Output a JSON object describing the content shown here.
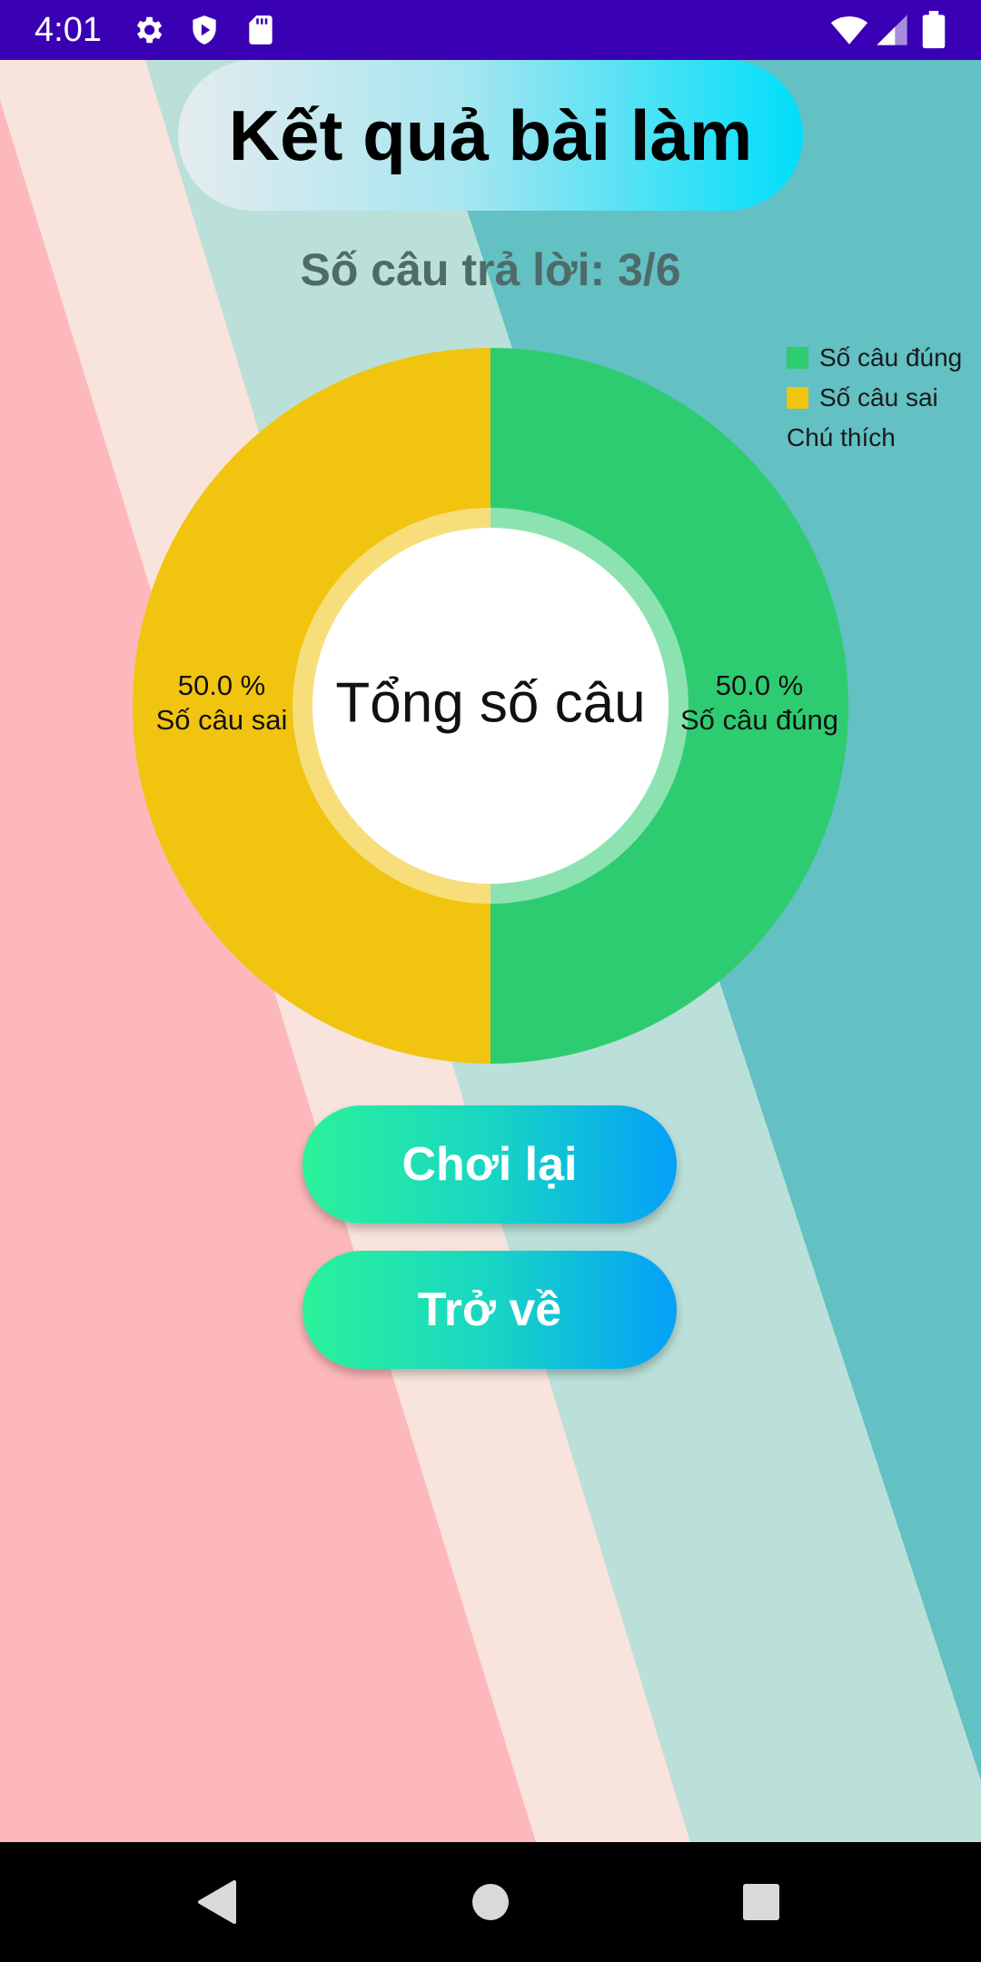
{
  "status_bar": {
    "time": "4:01",
    "icons_left": [
      "gear-icon",
      "shield-play-icon",
      "sd-card-icon"
    ],
    "icons_right": [
      "wifi-icon",
      "cellular-signal-icon",
      "battery-icon"
    ]
  },
  "header": {
    "title": "Kết quả bài làm"
  },
  "summary": {
    "answered_text": "Số câu trả lời: 3/6"
  },
  "legend": {
    "items": [
      {
        "label": "Số câu đúng",
        "color": "#2ecc71"
      },
      {
        "label": "Số câu sai",
        "color": "#f1c40f"
      }
    ],
    "title": "Chú thích"
  },
  "chart_data": {
    "type": "pie",
    "donut": true,
    "center_text": "Tổng số câu",
    "slices": [
      {
        "label": "Số câu đúng",
        "value": 50.0,
        "value_text": "50.0 %",
        "color": "#2ecc71"
      },
      {
        "label": "Số câu sai",
        "value": 50.0,
        "value_text": "50.0 %",
        "color": "#f1c40f"
      }
    ],
    "legend_placement": "top-right"
  },
  "buttons": {
    "replay": "Chơi lại",
    "back": "Trở về"
  },
  "colors": {
    "status_bar": "#3a00b4",
    "bg_pink": "#fdb8bb",
    "bg_cream": "#f8e4dd",
    "bg_mint": "#bbe0d9",
    "bg_teal": "#63c0c3"
  }
}
